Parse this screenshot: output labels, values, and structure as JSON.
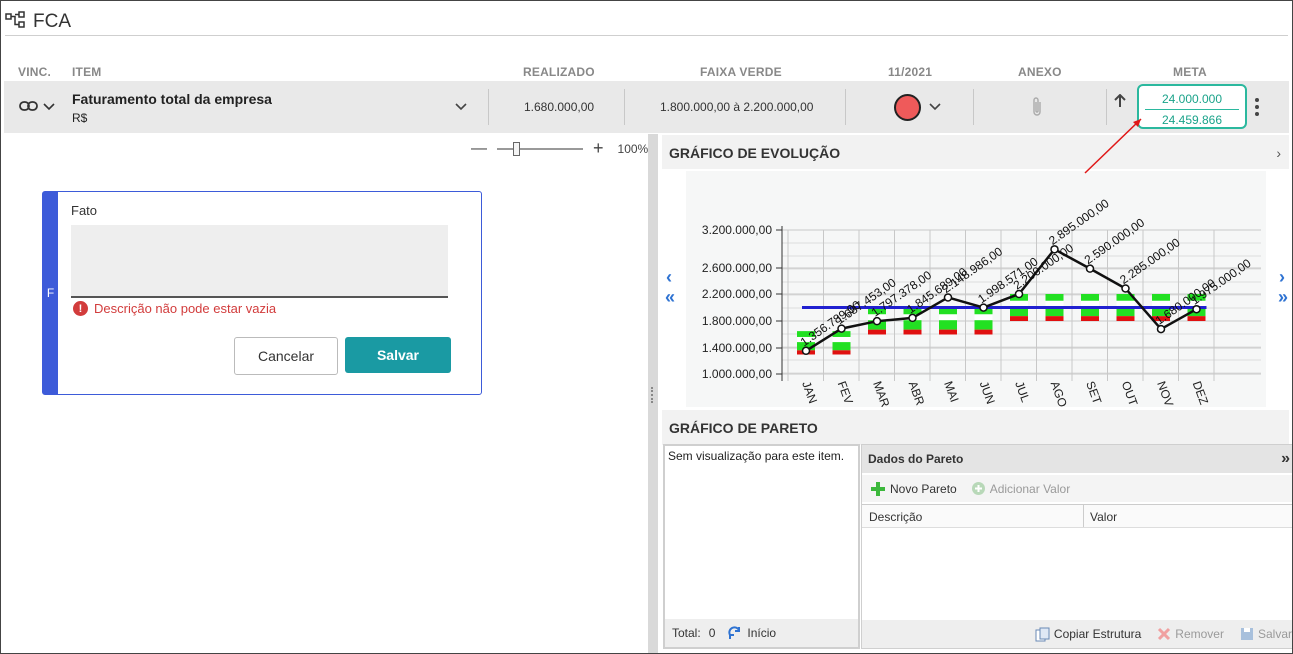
{
  "app": {
    "title": "FCA"
  },
  "table": {
    "headers": {
      "vinc": "VINC.",
      "item": "ITEM",
      "realizado": "REALIZADO",
      "faixa_verde": "FAIXA VERDE",
      "periodo": "11/2021",
      "anexo": "ANEXO",
      "meta": "META"
    },
    "row": {
      "item_name": "Faturamento total da empresa",
      "unit": "R$",
      "realizado": "1.680.000,00",
      "faixa_verde": "1.800.000,00 à 2.200.000,00",
      "status_color": "#ef5a5a",
      "meta_value": "24.000.000",
      "meta_projected": "24.459.866"
    }
  },
  "zoom": {
    "level": "100%",
    "fraction": 0.2
  },
  "form": {
    "side_letter": "F",
    "label": "Fato",
    "value": "",
    "error": "Descrição não pode estar vazia",
    "cancel_label": "Cancelar",
    "save_label": "Salvar"
  },
  "evolution": {
    "title": "GRÁFICO DE EVOLUÇÃO"
  },
  "chart_data": {
    "type": "line",
    "title": "",
    "categories": [
      "JAN",
      "FEV",
      "MAR",
      "ABR",
      "MAI",
      "JUN",
      "JUL",
      "AGO",
      "SET",
      "OUT",
      "NOV",
      "DEZ"
    ],
    "yticks": [
      "3.200.000,00",
      "2.600.000,00",
      "2.200.000,00",
      "1.800.000,00",
      "1.400.000,00",
      "1.000.000,00"
    ],
    "ylim": [
      1000000,
      3200000
    ],
    "series": [
      {
        "values": [
          1356789,
          1687453,
          1797378,
          1845689,
          2148986,
          1998571,
          2200000,
          2895000,
          2590000,
          2285000,
          1680000,
          1975000
        ],
        "labels": [
          "1.356.789,00",
          "1.687.453,00",
          "1.797.378,00",
          "1.845.689,00",
          "2.148.986,00",
          "1.998.571,00",
          "2.200.000,00",
          "2.895.000,00",
          "2.590.000,00",
          "2.285.000,00",
          "1.680.000,00",
          "1.975.000,00"
        ]
      }
    ],
    "target_line": 2000000,
    "bands": [
      {
        "low": 1300000,
        "high": 1650000
      },
      {
        "low": 1300000,
        "high": 1650000
      },
      {
        "low": 1600000,
        "high": 2000000
      },
      {
        "low": 1600000,
        "high": 2000000
      },
      {
        "low": 1600000,
        "high": 2000000
      },
      {
        "low": 1600000,
        "high": 2000000
      },
      {
        "low": 1800000,
        "high": 2200000
      },
      {
        "low": 1800000,
        "high": 2200000
      },
      {
        "low": 1800000,
        "high": 2200000
      },
      {
        "low": 1800000,
        "high": 2200000
      },
      {
        "low": 1800000,
        "high": 2200000
      },
      {
        "low": 1800000,
        "high": 2200000
      }
    ],
    "colors": {
      "line": "#111111",
      "target": "#2020d0",
      "green": "#22e022",
      "red": "#e01010"
    },
    "grid": true
  },
  "pareto": {
    "title": "GRÁFICO DE PARETO",
    "empty_message": "Sem visualização para este item.",
    "total_label": "Total:",
    "total_value": "0",
    "inicio_label": "Início",
    "panel_title": "Dados do Pareto",
    "novo_pareto": "Novo Pareto",
    "adicionar_valor": "Adicionar Valor",
    "col_descricao": "Descrição",
    "col_valor": "Valor",
    "copiar_estrutura": "Copiar Estrutura",
    "remover": "Remover",
    "salvar": "Salvar"
  }
}
